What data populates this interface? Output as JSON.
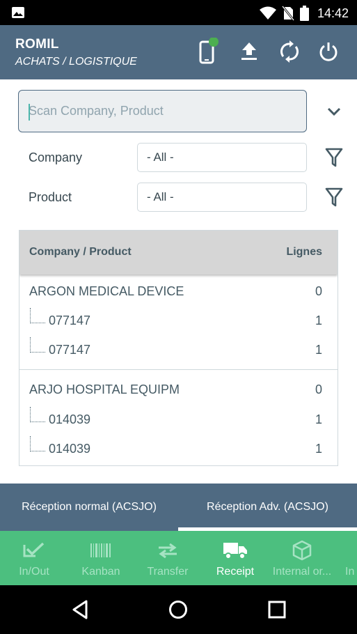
{
  "status_bar": {
    "time": "14:42"
  },
  "header": {
    "user": "ROMIL",
    "role": "ACHATS / LOGISTIQUE",
    "device_status_color": "#4caf50"
  },
  "scan": {
    "placeholder": "Scan Company, Product"
  },
  "filters": [
    {
      "label": "Company",
      "value": "- All -"
    },
    {
      "label": "Product",
      "value": "- All -"
    }
  ],
  "table": {
    "columns": [
      "Company / Product",
      "Lignes"
    ],
    "groups": [
      {
        "company": "ARGON MEDICAL DEVICE",
        "count": "0",
        "products": [
          {
            "code": "077147",
            "lines": "1"
          },
          {
            "code": "077147",
            "lines": "1"
          }
        ]
      },
      {
        "company": "ARJO HOSPITAL EQUIPM",
        "count": "0",
        "products": [
          {
            "code": "014039",
            "lines": "1"
          },
          {
            "code": "014039",
            "lines": "1"
          }
        ]
      }
    ]
  },
  "tabs": [
    {
      "label": "Réception normal (ACSJO)",
      "active": false
    },
    {
      "label": "Réception Adv. (ACSJO)",
      "active": true
    }
  ],
  "bottom_nav": [
    {
      "label": "In/Out",
      "icon": "check-icon",
      "active": false
    },
    {
      "label": "Kanban",
      "icon": "barcode-icon",
      "active": false
    },
    {
      "label": "Transfer",
      "icon": "transfer-icon",
      "active": false
    },
    {
      "label": "Receipt",
      "icon": "truck-icon",
      "active": true
    },
    {
      "label": "Internal or...",
      "icon": "box-icon",
      "active": false
    },
    {
      "label": "In",
      "icon": "",
      "active": false
    }
  ],
  "colors": {
    "header": "#4f6a82",
    "bottom_nav": "#4cbf7f",
    "accent_caret": "#4db6ac"
  }
}
